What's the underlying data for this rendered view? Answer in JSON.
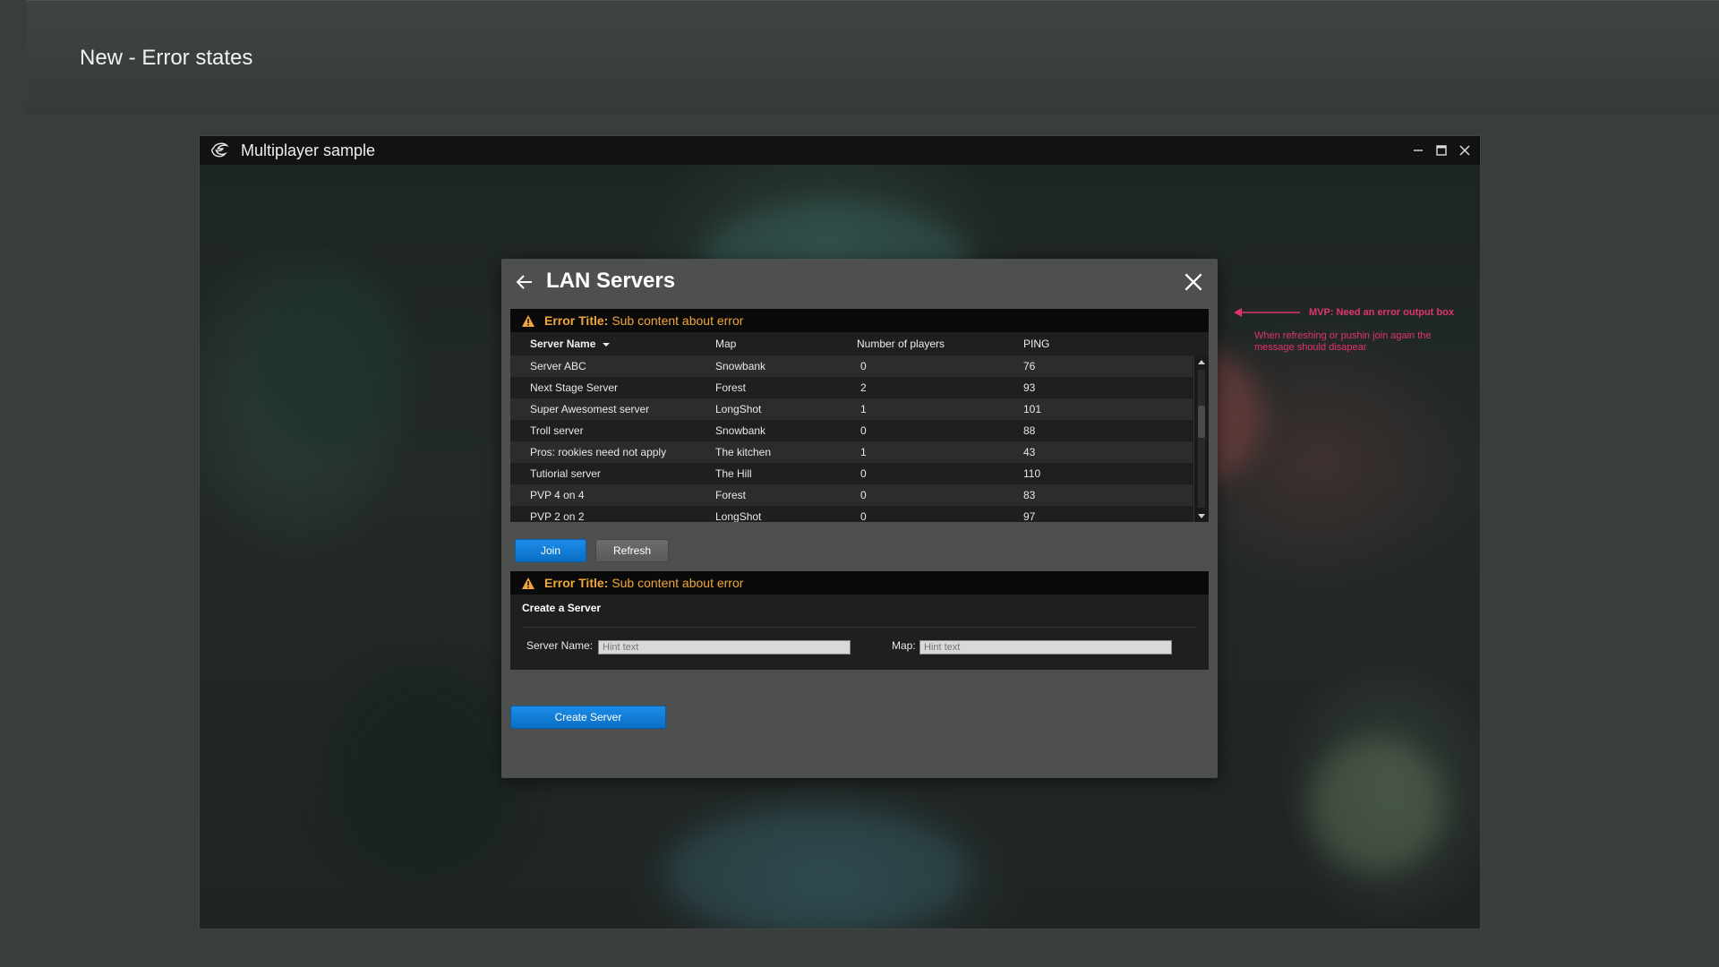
{
  "page": {
    "title": "New - Error states"
  },
  "window": {
    "app_title": "Multiplayer sample",
    "logo_icon": "game-logo-icon",
    "controls": {
      "minimize_icon": "minimize-icon",
      "maximize_icon": "maximize-icon",
      "close_icon": "close-icon"
    }
  },
  "dialog": {
    "title": "LAN Servers",
    "back_icon": "arrow-left-icon",
    "close_icon": "close-icon",
    "server_error": {
      "title": "Error Title:",
      "body": "Sub content about error",
      "icon": "warning-icon"
    },
    "table": {
      "columns": {
        "server_name": "Server Name",
        "map": "Map",
        "players": "Number of players",
        "ping": "PING"
      },
      "rows": [
        {
          "name": "Server ABC",
          "map": "Snowbank",
          "players": "0",
          "ping": "76"
        },
        {
          "name": "Next Stage Server",
          "map": "Forest",
          "players": "2",
          "ping": "93"
        },
        {
          "name": "Super Awesomest server",
          "map": "LongShot",
          "players": "1",
          "ping": "101"
        },
        {
          "name": "Troll server",
          "map": "Snowbank",
          "players": "0",
          "ping": "88"
        },
        {
          "name": "Pros: rookies need not apply",
          "map": "The kitchen",
          "players": "1",
          "ping": "43"
        },
        {
          "name": "Tutiorial server",
          "map": "The Hill",
          "players": "0",
          "ping": "110"
        },
        {
          "name": "PVP 4 on 4",
          "map": "Forest",
          "players": "0",
          "ping": "83"
        },
        {
          "name": "PVP 2 on 2",
          "map": "LongShot",
          "players": "0",
          "ping": "97"
        }
      ]
    },
    "buttons": {
      "join": "Join",
      "refresh": "Refresh",
      "create_server": "Create Server"
    },
    "create_error": {
      "title": "Error Title:",
      "body": "Sub content about error",
      "icon": "warning-icon"
    },
    "create": {
      "heading": "Create a Server",
      "server_name_label": "Server Name:",
      "server_name_placeholder": "Hint text",
      "map_label": "Map:",
      "map_placeholder": "Hint text"
    }
  },
  "annotation": {
    "title": "MVP: Need an error output box",
    "body": "When refreshing or pushin join again the message should disapear",
    "color": "#e0346b"
  },
  "colors": {
    "accent": "#0b6fc4",
    "warning": "#e8a21f",
    "error_text": "#f0a63a"
  }
}
